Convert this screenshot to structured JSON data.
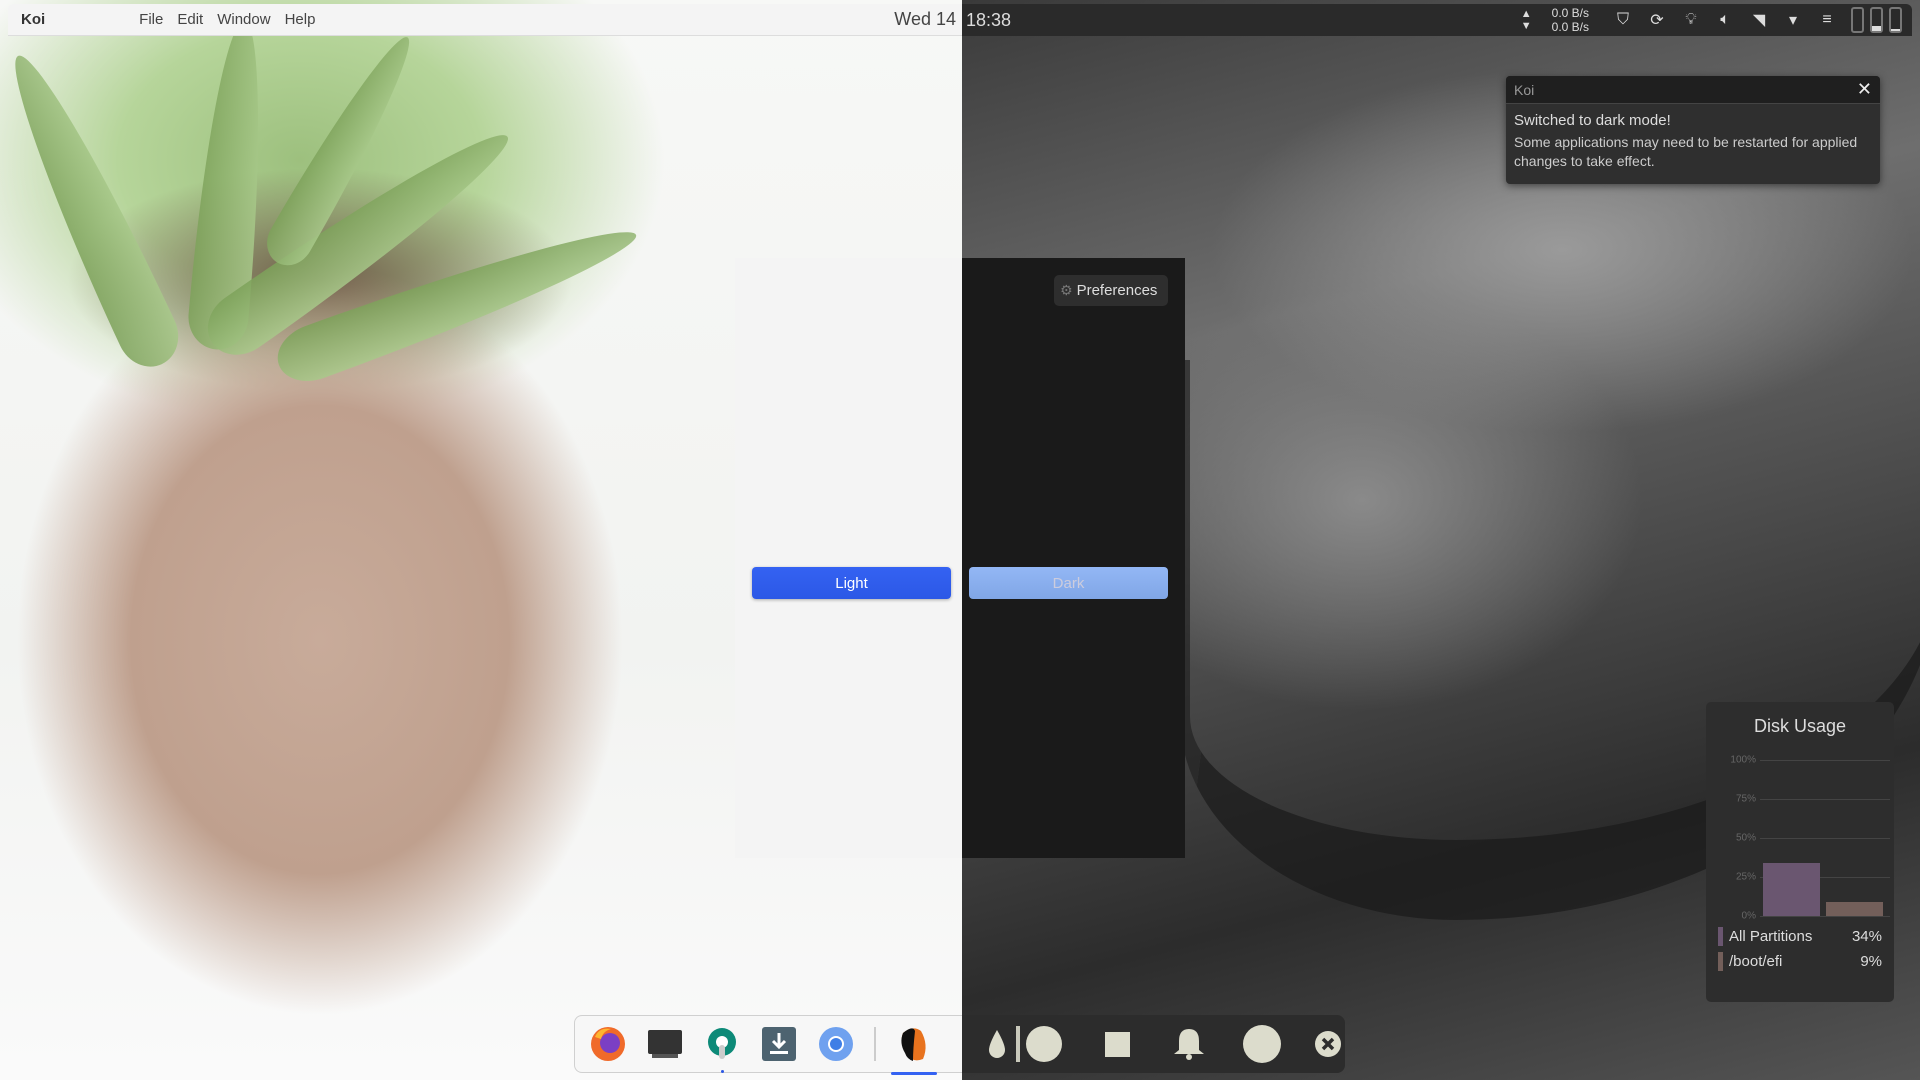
{
  "topbar": {
    "app_name": "Koi",
    "menu": [
      "File",
      "Edit",
      "Window",
      "Help"
    ],
    "clock_day": "Wed 14",
    "clock_time": "18:38",
    "net": {
      "up_rate": "0.0 B/s",
      "down_rate": "0.0 B/s"
    },
    "tray_icons": [
      "shield-info-icon",
      "sync-icon",
      "lightbulb-icon",
      "volume-icon",
      "wifi-icon",
      "dropdown-icon",
      "hamburger-menu-icon"
    ],
    "batteries": [
      0.0,
      0.25,
      0.08
    ]
  },
  "notification": {
    "app": "Koi",
    "title": "Switched to dark mode!",
    "body": "Some applications may need to be restarted for applied changes to take effect."
  },
  "koi_window": {
    "preferences_label": "Preferences",
    "light_label": "Light",
    "dark_label": "Dark"
  },
  "disk_usage": {
    "title": "Disk Usage",
    "colors": {
      "all_partitions": "#6a5670",
      "boot_efi": "#735f5a"
    },
    "chart_data": {
      "type": "bar",
      "title": "Disk Usage",
      "categories": [
        "All Partitions",
        "/boot/efi"
      ],
      "values": [
        34,
        9
      ],
      "yticks": [
        "100%",
        "75%",
        "50%",
        "25%",
        "0%"
      ],
      "ylim": [
        0,
        100
      ],
      "legend": [
        {
          "label": "All Partitions",
          "value": "34%"
        },
        {
          "label": "/boot/efi",
          "value": "9%"
        }
      ]
    }
  },
  "dock": {
    "left_apps": [
      "Firefox",
      "Terminal",
      "Settings",
      "Downloads",
      "Chromium",
      "Koi"
    ],
    "right_icons": [
      "droplet-icon",
      "circle-icon",
      "square-icon",
      "bell-icon",
      "circle-icon",
      "close-circle-icon"
    ]
  },
  "accent": "#3462f2"
}
